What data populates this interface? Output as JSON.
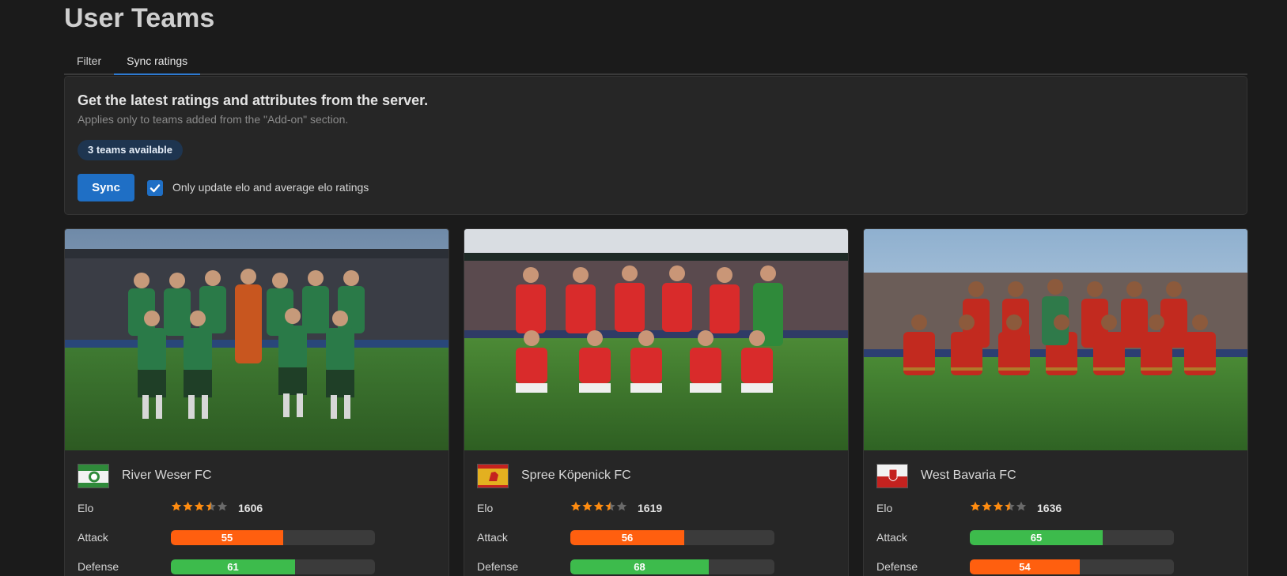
{
  "page": {
    "title": "User Teams"
  },
  "tabs": [
    {
      "label": "Filter",
      "active": false
    },
    {
      "label": "Sync ratings",
      "active": true
    }
  ],
  "sync_panel": {
    "heading": "Get the latest ratings and attributes from the server.",
    "subtext": "Applies only to teams added from the \"Add-on\" section.",
    "badge": "3 teams available",
    "sync_label": "Sync",
    "checkbox_label": "Only update elo and average elo ratings",
    "checkbox_checked": true
  },
  "labels": {
    "elo": "Elo",
    "attack": "Attack",
    "defense": "Defense"
  },
  "colors": {
    "accent": "#1f6fc5",
    "orange": "#ff5f0f",
    "green": "#3dbb4c",
    "star": "#ff8c10"
  },
  "teams": [
    {
      "name": "River Weser FC",
      "photo": "Team photo: players in green kits, goalkeeper in orange, stadium",
      "stars": 3.5,
      "elo": "1606",
      "attack": 55,
      "attack_color": "orange",
      "defense": 61,
      "defense_color": "green"
    },
    {
      "name": "Spree Köpenick FC",
      "photo": "Team photo: players in red kits, goalkeeper in green, stadium",
      "stars": 3.5,
      "elo": "1619",
      "attack": 56,
      "attack_color": "orange",
      "defense": 68,
      "defense_color": "green"
    },
    {
      "name": "West Bavaria FC",
      "photo": "Team photo: players in red kits with gold trim, stadium",
      "stars": 3.5,
      "elo": "1636",
      "attack": 65,
      "attack_color": "green",
      "defense": 54,
      "defense_color": "orange"
    }
  ]
}
